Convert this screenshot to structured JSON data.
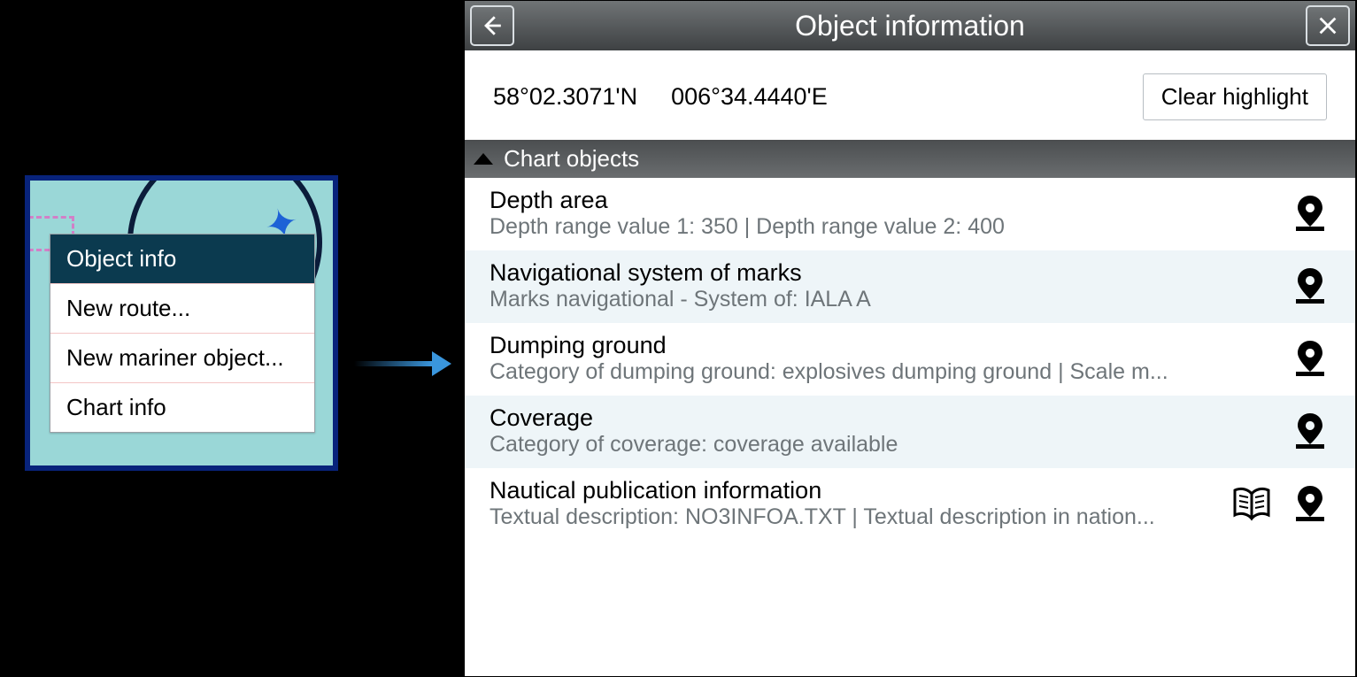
{
  "contextMenu": {
    "items": [
      {
        "label": "Object info",
        "selected": true
      },
      {
        "label": "New route...",
        "selected": false
      },
      {
        "label": "New mariner object...",
        "selected": false
      },
      {
        "label": "Chart info",
        "selected": false
      }
    ]
  },
  "dialog": {
    "title": "Object information",
    "coords": {
      "lat": "58°02.3071'N",
      "lon": "006°34.4440'E"
    },
    "clear_btn": "Clear highlight",
    "section_header": "Chart objects",
    "objects": [
      {
        "title": "Depth area",
        "sub": "Depth range value 1: 350 | Depth range value 2: 400",
        "book": false
      },
      {
        "title": "Navigational system of marks",
        "sub": "Marks navigational - System of: IALA A",
        "book": false
      },
      {
        "title": "Dumping ground",
        "sub": "Category of dumping ground: explosives dumping ground | Scale m...",
        "book": false
      },
      {
        "title": "Coverage",
        "sub": "Category of coverage: coverage available",
        "book": false
      },
      {
        "title": "Nautical publication information",
        "sub": "Textual description: NO3INFOA.TXT | Textual description in nation...",
        "book": true
      }
    ]
  }
}
